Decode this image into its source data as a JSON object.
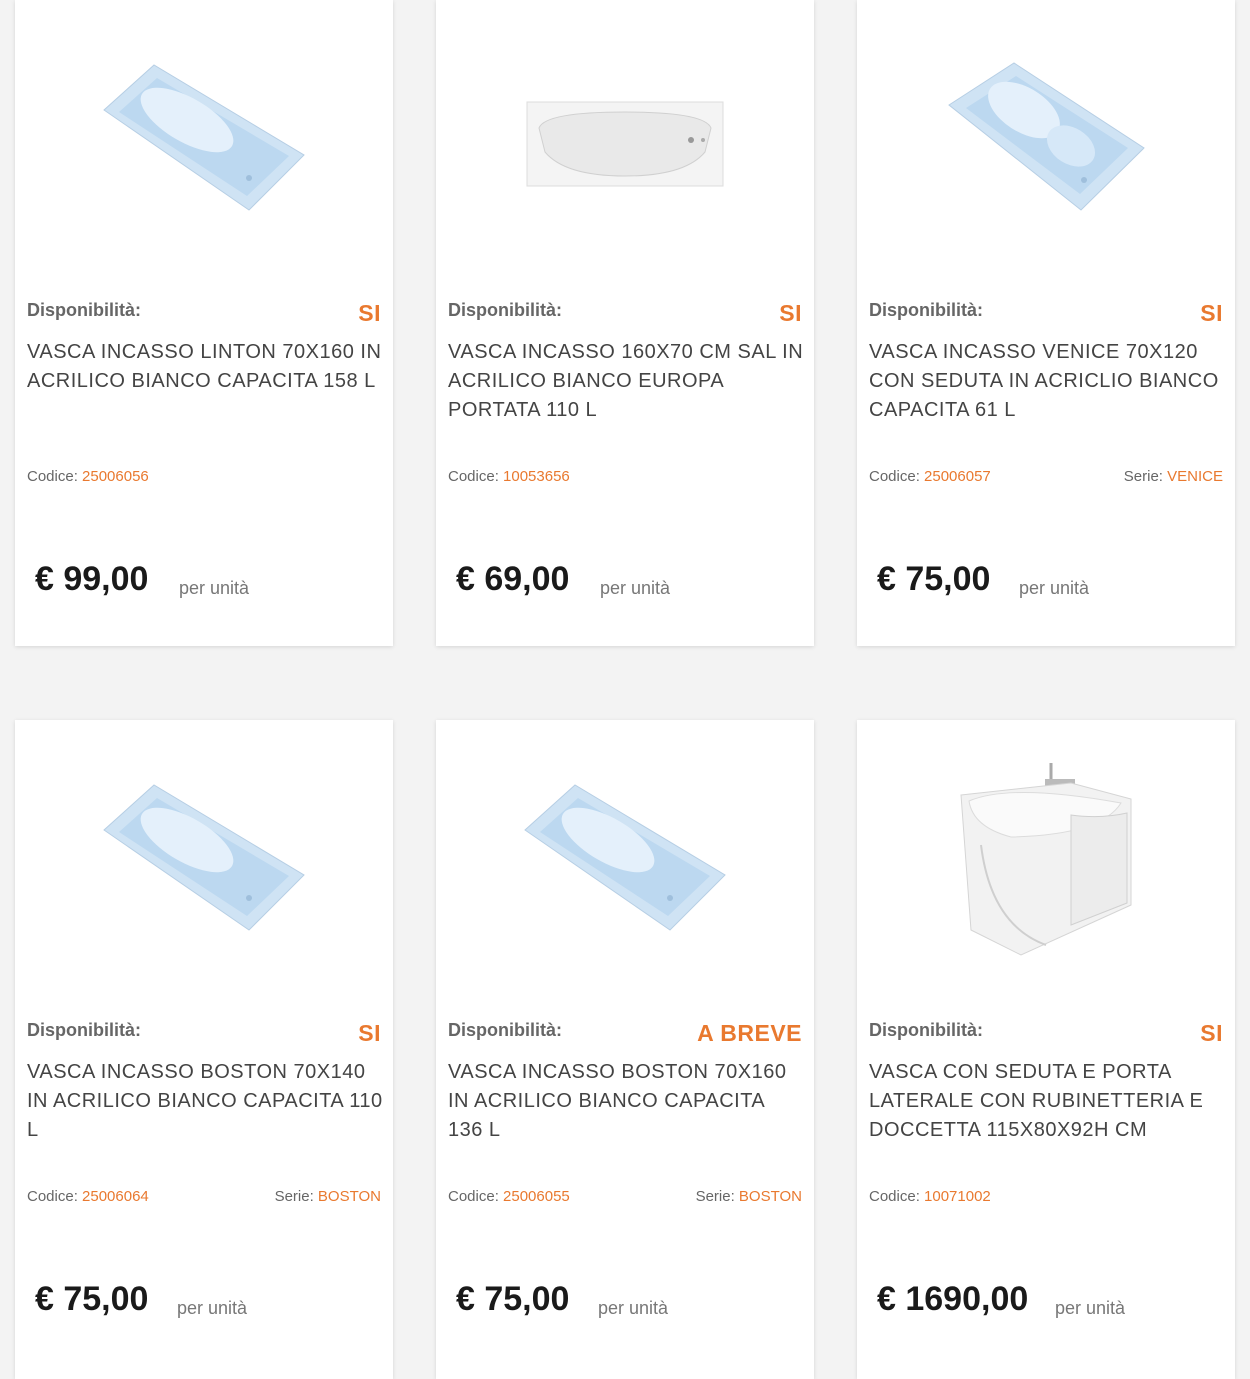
{
  "availability_label": "Disponibilità:",
  "code_label": "Codice: ",
  "serie_label": "Serie: ",
  "unit_label": "per unità",
  "colors": {
    "accent": "#e9792f",
    "text": "#444444",
    "background": "#f3f3f3"
  },
  "products": [
    {
      "availability": "SI",
      "title": "VASCA INCASSO LINTON 70X160 IN ACRILICO BIANCO CAPACITA 158 L",
      "code": "25006056",
      "serie": "",
      "price": "€ 99,00",
      "image_icon": "bathtub-angled-icon"
    },
    {
      "availability": "SI",
      "title": "VASCA INCASSO 160X70 CM SAL IN ACRILICO BIANCO EUROPA PORTATA 110 L",
      "code": "10053656",
      "serie": "",
      "price": "€ 69,00",
      "image_icon": "bathtub-front-icon"
    },
    {
      "availability": "SI",
      "title": "VASCA INCASSO VENICE 70X120 CON SEDUTA IN ACRICLIO BIANCO CAPACITA 61 L",
      "code": "25006057",
      "serie": "VENICE",
      "price": "€ 75,00",
      "image_icon": "bathtub-seat-icon"
    },
    {
      "availability": "SI",
      "title": "VASCA INCASSO BOSTON 70X140 IN ACRILICO BIANCO CAPACITA 110 L",
      "code": "25006064",
      "serie": "BOSTON",
      "price": "€ 75,00",
      "image_icon": "bathtub-angled-icon"
    },
    {
      "availability": "A BREVE",
      "title": "VASCA INCASSO BOSTON 70X160 IN ACRILICO BIANCO CAPACITA 136 L",
      "code": "25006055",
      "serie": "BOSTON",
      "price": "€ 75,00",
      "image_icon": "bathtub-angled-icon"
    },
    {
      "availability": "SI",
      "title": "VASCA CON SEDUTA E PORTA LATERALE CON RUBINETTERIA E DOCCETTA 115X80X92H CM",
      "code": "10071002",
      "serie": "",
      "price": "€ 1690,00",
      "image_icon": "walk-in-tub-icon"
    }
  ]
}
